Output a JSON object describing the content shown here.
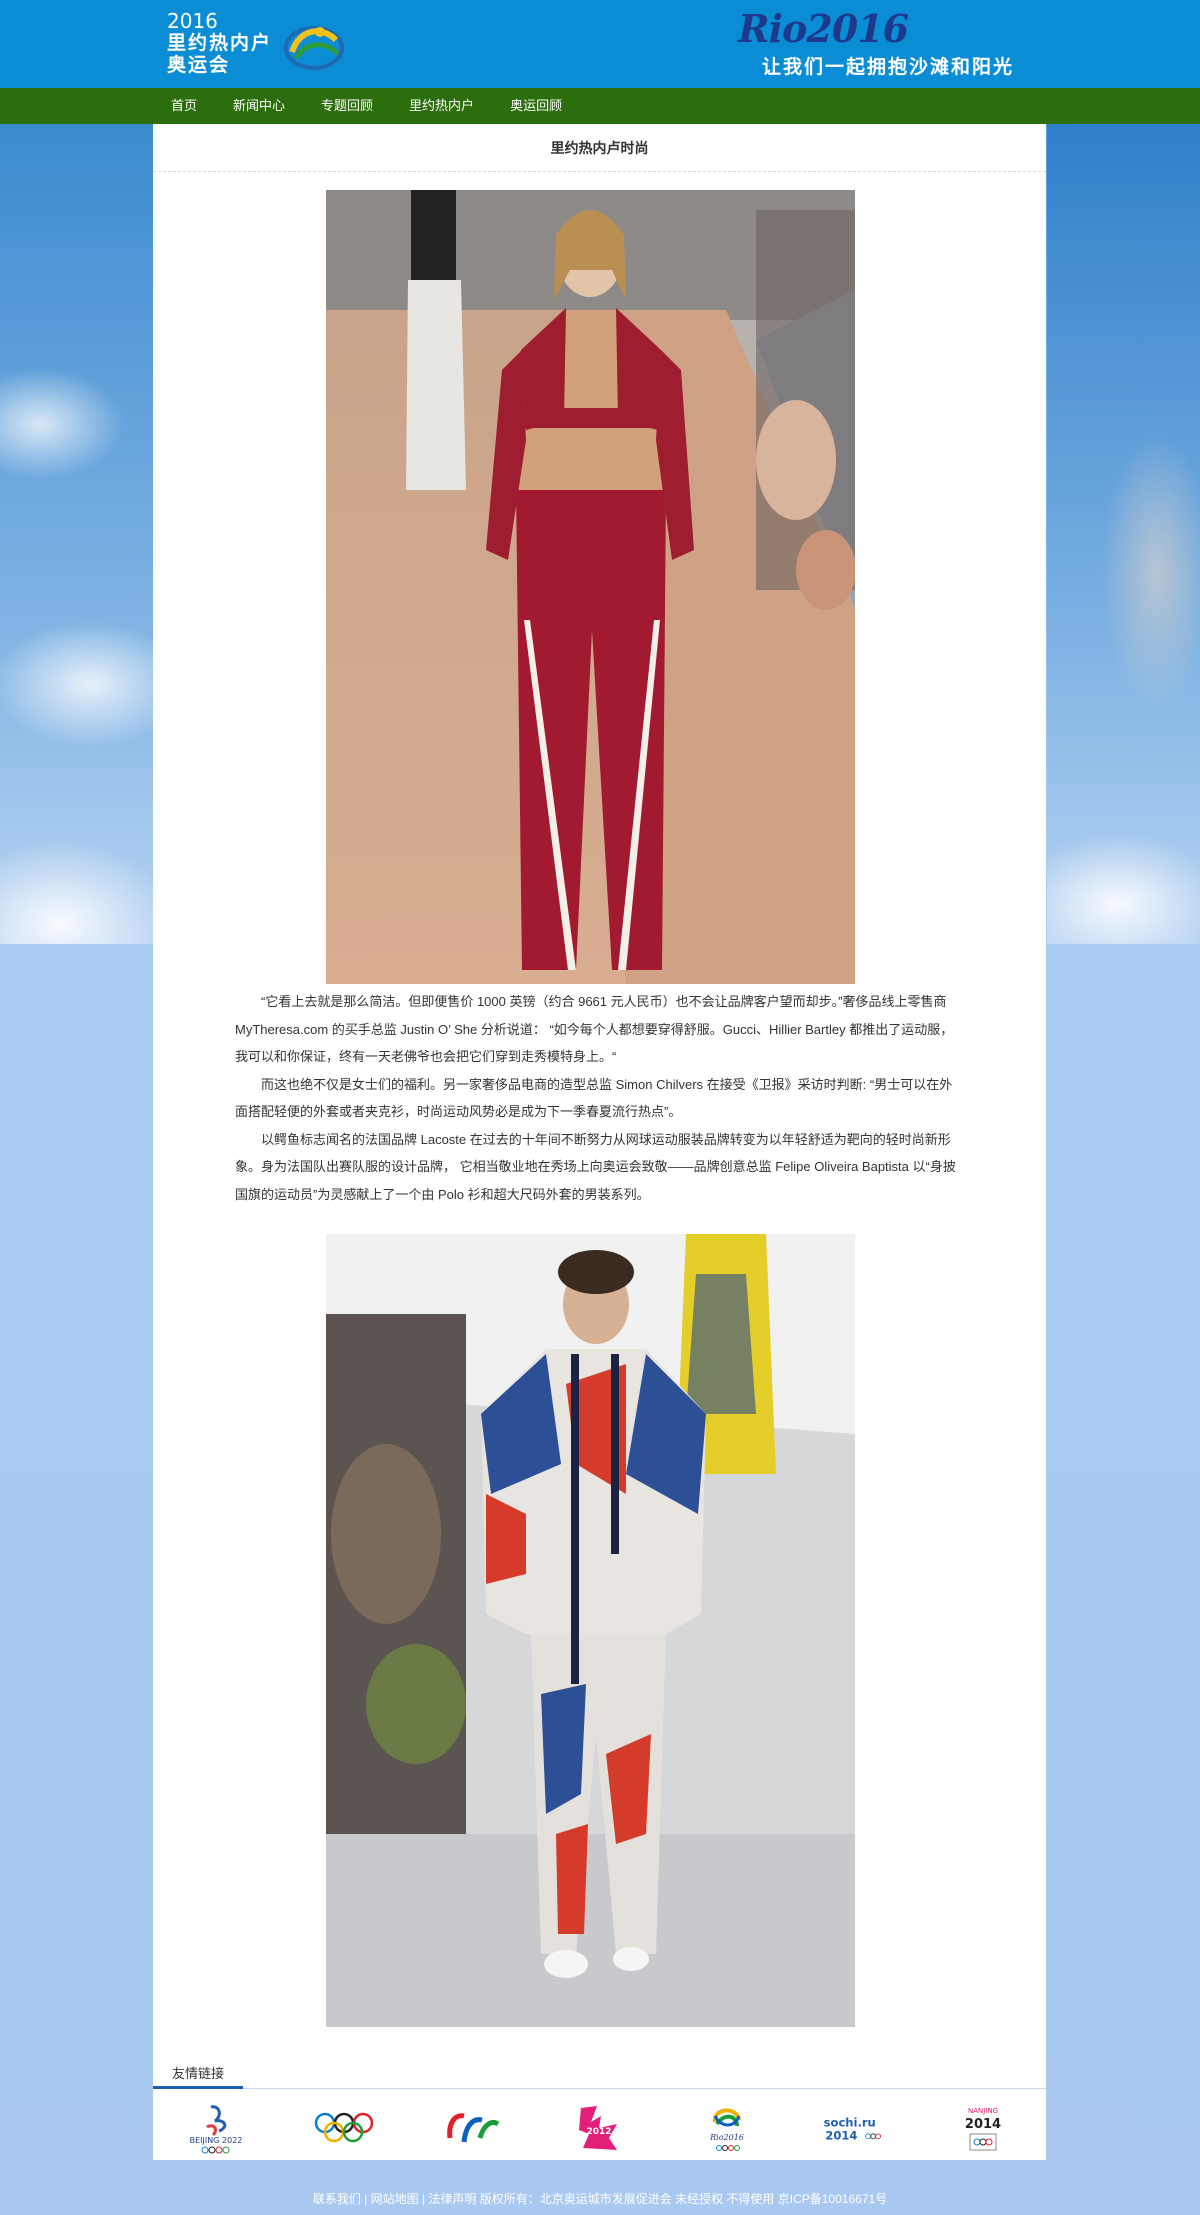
{
  "header": {
    "year": "2016",
    "brand_line1": "里约热内户",
    "brand_line2": "奥运会",
    "rio_title": "Rio2016",
    "slogan": "让我们一起拥抱沙滩和阳光"
  },
  "nav": {
    "items": [
      "首页",
      "新闻中心",
      "专题回顾",
      "里约热内户",
      "奥运回顾"
    ]
  },
  "page": {
    "title": "里约热内卢时尚"
  },
  "article": {
    "paragraphs": [
      "“它看上去就是那么简洁。但即便售价 1000 英镑（约合 9661 元人民币）也不会让品牌客户望而却步。”奢侈品线上零售商 MyTheresa.com 的买手总监 Justin O’ She 分析说道： “如今每个人都想要穿得舒服。Gucci、Hillier Bartley 都推出了运动服，我可以和你保证，终有一天老佛爷也会把它们穿到走秀模特身上。“",
      "而这也绝不仅是女士们的福利。另一家奢侈品电商的造型总监 Simon Chilvers 在接受《卫报》采访时判断: “男士可以在外面搭配轻便的外套或者夹克衫，时尚运动风势必是成为下一季春夏流行热点”。",
      "以鳄鱼标志闻名的法国品牌 Lacoste 在过去的十年间不断努力从网球运动服装品牌转变为以年轻舒适为靶向的轻时尚新形象。身为法国队出赛队服的设计品牌， 它相当敬业地在秀场上向奥运会致敬——品牌创意总监 Felipe Oliveira Baptista 以“身披国旗的运动员”为灵感献上了一个由 Polo 衫和超大尺码外套的男装系列。"
    ]
  },
  "friend_links": {
    "title": "友情链接",
    "logos": [
      {
        "name": "beijing-2022-logo",
        "text": "BEIJING 2022"
      },
      {
        "name": "olympic-rings-logo",
        "text": ""
      },
      {
        "name": "paralympic-logo",
        "text": ""
      },
      {
        "name": "london-2012-logo",
        "text": "2012"
      },
      {
        "name": "rio-2016-logo",
        "text": "Rio2016"
      },
      {
        "name": "sochi-2014-logo",
        "text": "sochi.ru 2014"
      },
      {
        "name": "nanjing-2014-logo",
        "text": "NANJING 2014"
      }
    ]
  },
  "footer": {
    "text": "联系我们 | 网站地图 | 法律声明 版权所有：北京奥运城市发展促进会 未经授权   不得使用 京ICP备10016671号"
  },
  "colors": {
    "header_bg": "#0b8dd6",
    "nav_bg": "#2c6e0d",
    "link_accent": "#1a5fb4"
  }
}
